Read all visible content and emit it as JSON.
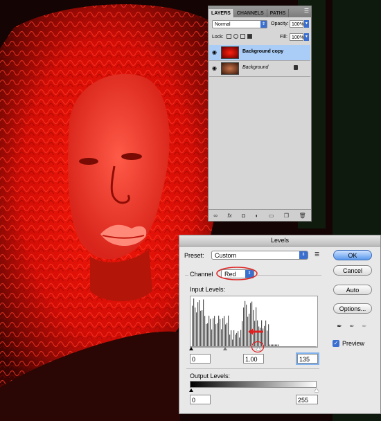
{
  "layers_panel": {
    "tabs": [
      "LAYERS",
      "CHANNELS",
      "PATHS"
    ],
    "menu_icon": "panel-menu-icon",
    "blend_mode": "Normal",
    "opacity_label": "Opacity:",
    "opacity_value": "100%",
    "lock_label": "Lock:",
    "fill_label": "Fill:",
    "fill_value": "100%",
    "layers": [
      {
        "name": "Background copy",
        "selected": true
      },
      {
        "name": "Background",
        "selected": false,
        "locked": true
      }
    ],
    "footer_icons": [
      "link-icon",
      "fx-icon",
      "mask-icon",
      "adjustment-icon",
      "folder-icon",
      "new-layer-icon",
      "trash-icon"
    ]
  },
  "levels": {
    "title": "Levels",
    "preset_label": "Preset:",
    "preset_value": "Custom",
    "channel_label": "Channel",
    "channel_value": "Red",
    "input_levels_label": "Input Levels:",
    "input_black": "0",
    "input_gamma": "1.00",
    "input_white": "135",
    "output_levels_label": "Output Levels:",
    "output_black": "0",
    "output_white": "255",
    "buttons": {
      "ok": "OK",
      "cancel": "Cancel",
      "auto": "Auto",
      "options": "Options..."
    },
    "preview_label": "Preview",
    "preview_checked": true,
    "annotation_color": "#e02020"
  }
}
